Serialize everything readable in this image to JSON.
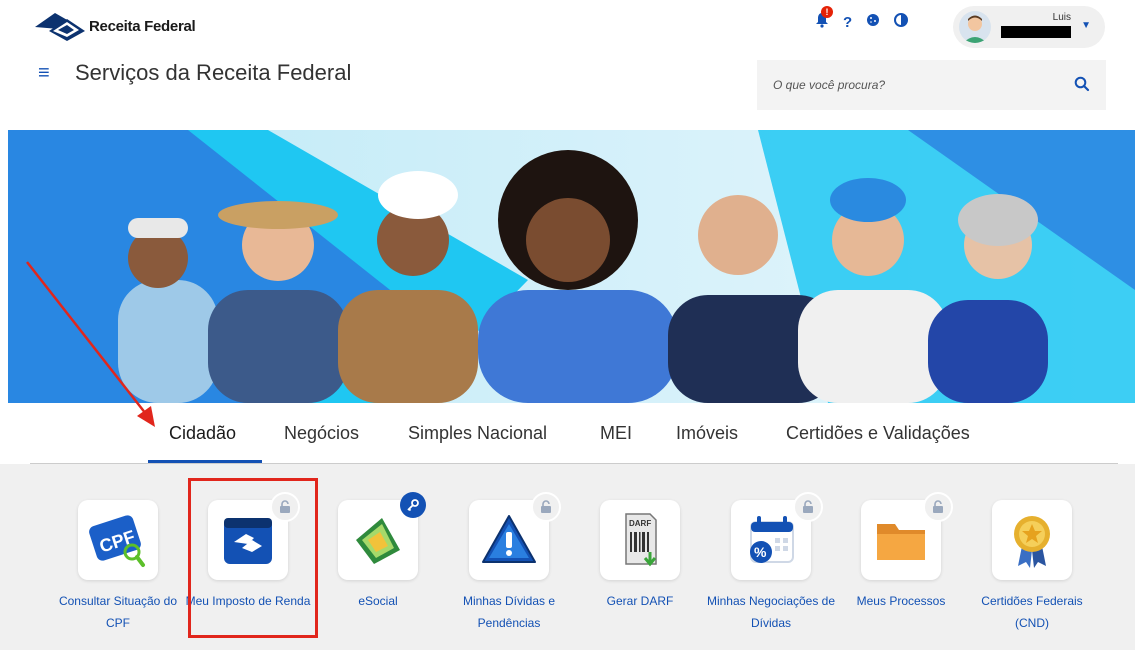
{
  "header": {
    "brand": "Receita Federal",
    "page_title": "Serviços da Receita Federal",
    "user_name": "Luis",
    "notification_count": "!",
    "help_icon_text": "?"
  },
  "search": {
    "placeholder": "O que você procura?"
  },
  "tabs": [
    {
      "label": "Cidadão",
      "active": true
    },
    {
      "label": "Negócios"
    },
    {
      "label": "Simples Nacional"
    },
    {
      "label": "MEI"
    },
    {
      "label": "Imóveis"
    },
    {
      "label": "Certidões e Validações"
    }
  ],
  "services": [
    {
      "label": "Consultar Situação do CPF",
      "icon": "cpf-icon"
    },
    {
      "label": "Meu Imposto de Renda",
      "icon": "imposto-renda-icon",
      "locked": true
    },
    {
      "label": "eSocial",
      "icon": "esocial-icon",
      "key": true
    },
    {
      "label": "Minhas Dívidas e Pendências",
      "icon": "warning-icon",
      "locked": true
    },
    {
      "label": "Gerar DARF",
      "icon": "darf-icon"
    },
    {
      "label": "Minhas Negociações de Dívidas",
      "icon": "calendar-percent-icon",
      "locked": true
    },
    {
      "label": "Meus Processos",
      "icon": "folder-icon",
      "locked": true
    },
    {
      "label": "Certidões Federais (CND)",
      "icon": "medal-icon"
    }
  ],
  "colors": {
    "primary": "#1351b4",
    "annotation": "#e1261c",
    "hero_cyan": "#1fc7f2"
  }
}
